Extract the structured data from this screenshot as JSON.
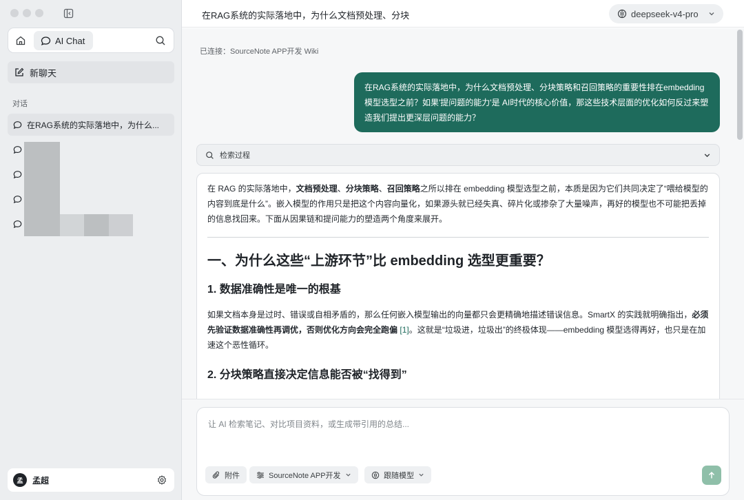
{
  "sidebar": {
    "nav_tab_label": "AI Chat",
    "new_chat_label": "新聊天",
    "section_label": "对话",
    "active_conversation": "在RAG系统的实际落地中，为什么...",
    "user_avatar": "孟",
    "user_name": "孟超"
  },
  "header": {
    "title": "在RAG系统的实际落地中，为什么文档预处理、分块",
    "model": "deepseek-v4-pro"
  },
  "chat": {
    "connected": "已连接：SourceNote APP开发 Wiki",
    "user_message": "在RAG系统的实际落地中，为什么文档预处理、分块策略和召回策略的重要性排在embedding模型选型之前？如果'提问题的能力'是 AI时代的核心价值，那这些技术层面的优化如何反过来塑造我们提出更深层问题的能力？",
    "retrieval_label": "检索过程",
    "answer": {
      "intro_1": "在 RAG 的实际落地中，",
      "intro_bold_1": "文档预处理",
      "intro_sep_1": "、",
      "intro_bold_2": "分块策略",
      "intro_sep_2": "、",
      "intro_bold_3": "召回策略",
      "intro_2": "之所以排在 embedding 模型选型之前，本质是因为它们共同决定了“喂给模型的内容到底是什么”。嵌入模型的作用只是把这个内容向量化，如果源头就已经失真、碎片化或掺杂了大量噪声，再好的模型也不可能把丢掉的信息找回来。下面从因果链和提问能力的塑造两个角度来展开。",
      "h2": "一、为什么这些“上游环节”比 embedding 选型更重要？",
      "h3_1": "1. 数据准确性是唯一的根基",
      "p1_a": "如果文档本身是过时、错误或自相矛盾的，那么任何嵌入模型输出的向量都只会更精确地描述错误信息。SmartX 的实践就明确指出，",
      "p1_bold": "必须先验证数据准确性再调优，否则优化方向会完全跑偏",
      "p1_cite": "[1]",
      "p1_b": "。这就是“垃圾进，垃圾出”的终极体现——embedding 模型选得再好，也只是在加速这个恶性循环。",
      "h3_2": "2. 分块策略直接决定信息能否被“找得到”"
    }
  },
  "composer": {
    "placeholder": "让 AI 检索笔记、对比项目资料，或生成带引用的总结...",
    "attach_label": "附件",
    "project_label": "SourceNote APP开发",
    "model_label": "跟随模型"
  }
}
